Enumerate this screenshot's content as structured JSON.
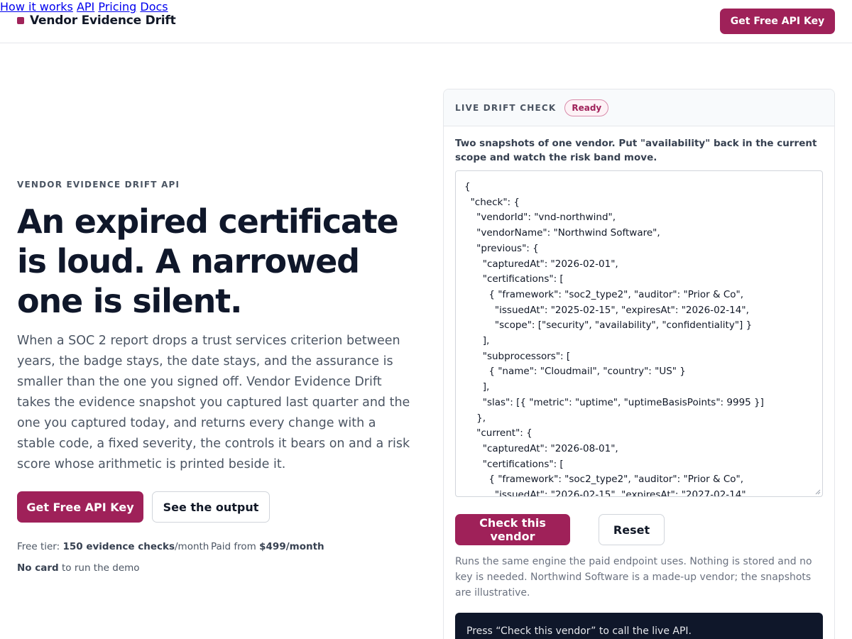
{
  "header": {
    "brand": "Vendor Evidence Drift",
    "nav": [
      "How it works",
      "API",
      "Pricing",
      "Docs"
    ],
    "cta": "Get Free API Key"
  },
  "hero": {
    "eyebrow": "VENDOR EVIDENCE DRIFT API",
    "headline_lines": [
      "An expired certificate",
      "is loud. A narrowed",
      "one is silent."
    ],
    "lead": "When a SOC 2 report drops a trust services criterion between years, the badge stays, the date stays, and the assurance is smaller than the one you signed off. Vendor Evidence Drift takes the evidence snapshot you captured last quarter and the one you captured today, and returns every change with a stable code, a fixed severity, the controls it bears on and a risk score whose arithmetic is printed beside it.",
    "cta_primary": "Get Free API Key",
    "cta_secondary": "See the output",
    "meta": {
      "free_label": "Free tier: ",
      "free_value": "150 evidence checks",
      "free_suffix": "/month",
      "paid_label": "Paid from ",
      "paid_value": "$499/month",
      "nocard_value": "No card",
      "nocard_suffix": " to run the demo"
    }
  },
  "panel": {
    "title": "LIVE DRIFT CHECK",
    "status": "Ready",
    "intro": "Two snapshots of one vendor. Put \"availability\" back in the current scope and watch the risk band move.",
    "editor_value": "{\n  \"check\": {\n    \"vendorId\": \"vnd-northwind\",\n    \"vendorName\": \"Northwind Software\",\n    \"previous\": {\n      \"capturedAt\": \"2026-02-01\",\n      \"certifications\": [\n        { \"framework\": \"soc2_type2\", \"auditor\": \"Prior & Co\",\n          \"issuedAt\": \"2025-02-15\", \"expiresAt\": \"2026-02-14\",\n          \"scope\": [\"security\", \"availability\", \"confidentiality\"] }\n      ],\n      \"subprocessors\": [\n        { \"name\": \"Cloudmail\", \"country\": \"US\" }\n      ],\n      \"slas\": [{ \"metric\": \"uptime\", \"uptimeBasisPoints\": 9995 }]\n    },\n    \"current\": {\n      \"capturedAt\": \"2026-08-01\",\n      \"certifications\": [\n        { \"framework\": \"soc2_type2\", \"auditor\": \"Prior & Co\",\n          \"issuedAt\": \"2026-02-15\", \"expiresAt\": \"2027-02-14\",",
    "check_button": "Check this vendor",
    "reset_button": "Reset",
    "note": "Runs the same engine the paid endpoint uses. Nothing is stored and no key is needed. Northwind Software is a made-up vendor; the snapshots are illustrative.",
    "console_text": "Press “Check this vendor” to call the live API."
  },
  "colors": {
    "accent": "#9f2159",
    "console_bg": "#0f172a"
  }
}
